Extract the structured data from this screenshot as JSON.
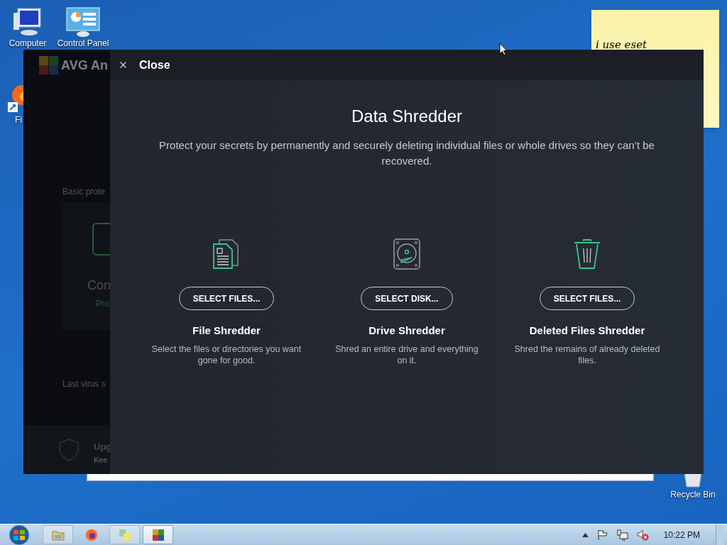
{
  "desktop_icons": [
    {
      "kind": "computer",
      "label": "Computer"
    },
    {
      "kind": "control-panel",
      "label": "Control Panel"
    },
    {
      "kind": "firefox",
      "label": "Fi"
    },
    {
      "kind": "recycle-bin",
      "label": "Recycle Bin"
    }
  ],
  "sticky_note": {
    "text": "i use eset"
  },
  "background_app": {
    "logo_text": "AVG An",
    "section_label": "Basic prote",
    "card_title": "Con",
    "card_status": "Pro",
    "last_scan": "Last virus s",
    "upgrade_title": "Upg",
    "upgrade_text": "Kee"
  },
  "shredder": {
    "close_label": "Close",
    "title": "Data Shredder",
    "description": "Protect your secrets by permanently and securely deleting individual files or whole drives so they can’t be recovered.",
    "tools": [
      {
        "kind": "file",
        "button": "SELECT FILES...",
        "title": "File Shredder",
        "description": "Select the files or directories you want gone for good."
      },
      {
        "kind": "drive",
        "button": "SELECT DISK...",
        "title": "Drive Shredder",
        "description": "Shred an entire drive and everything on it."
      },
      {
        "kind": "trash",
        "button": "SELECT FILES...",
        "title": "Deleted Files Shredder",
        "description": "Shred the remains of already deleted files."
      }
    ]
  },
  "taskbar": {
    "apps": [
      {
        "kind": "explorer",
        "selected": false
      },
      {
        "kind": "firefox",
        "selected": false
      },
      {
        "kind": "tool",
        "selected": false
      },
      {
        "kind": "avg",
        "selected": true
      }
    ],
    "clock": "10:22 PM"
  }
}
